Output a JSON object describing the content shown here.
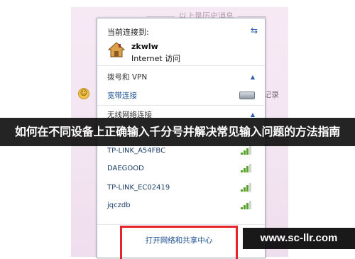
{
  "background": {
    "history_label": "以上是历史消息",
    "right_text": "记录"
  },
  "panel": {
    "current_label": "当前连接到:",
    "network": {
      "name": "zkwlw",
      "status": "Internet 访问"
    },
    "dialup_section": "拨号和 VPN",
    "broadband": "宽带连接",
    "wireless_section": "无线网络连接",
    "wifi": [
      {
        "name": "TP-LINK_A54FBC",
        "signal": 4
      },
      {
        "name": "DAEGOOD",
        "signal": 4
      },
      {
        "name": "TP-LINK_EC02419",
        "signal": 4
      },
      {
        "name": "jqczdb",
        "signal": 4
      }
    ],
    "open_center": "打开网络和共享中心"
  },
  "banner": {
    "title": "如何在不同设备上正确输入千分号并解决常见输入问题的方法指南"
  },
  "watermark": {
    "text": "www.sc-llr.com"
  },
  "colors": {
    "highlight_box": "#e6242b",
    "link": "#1a4f8f",
    "signal": "#59a32a"
  }
}
